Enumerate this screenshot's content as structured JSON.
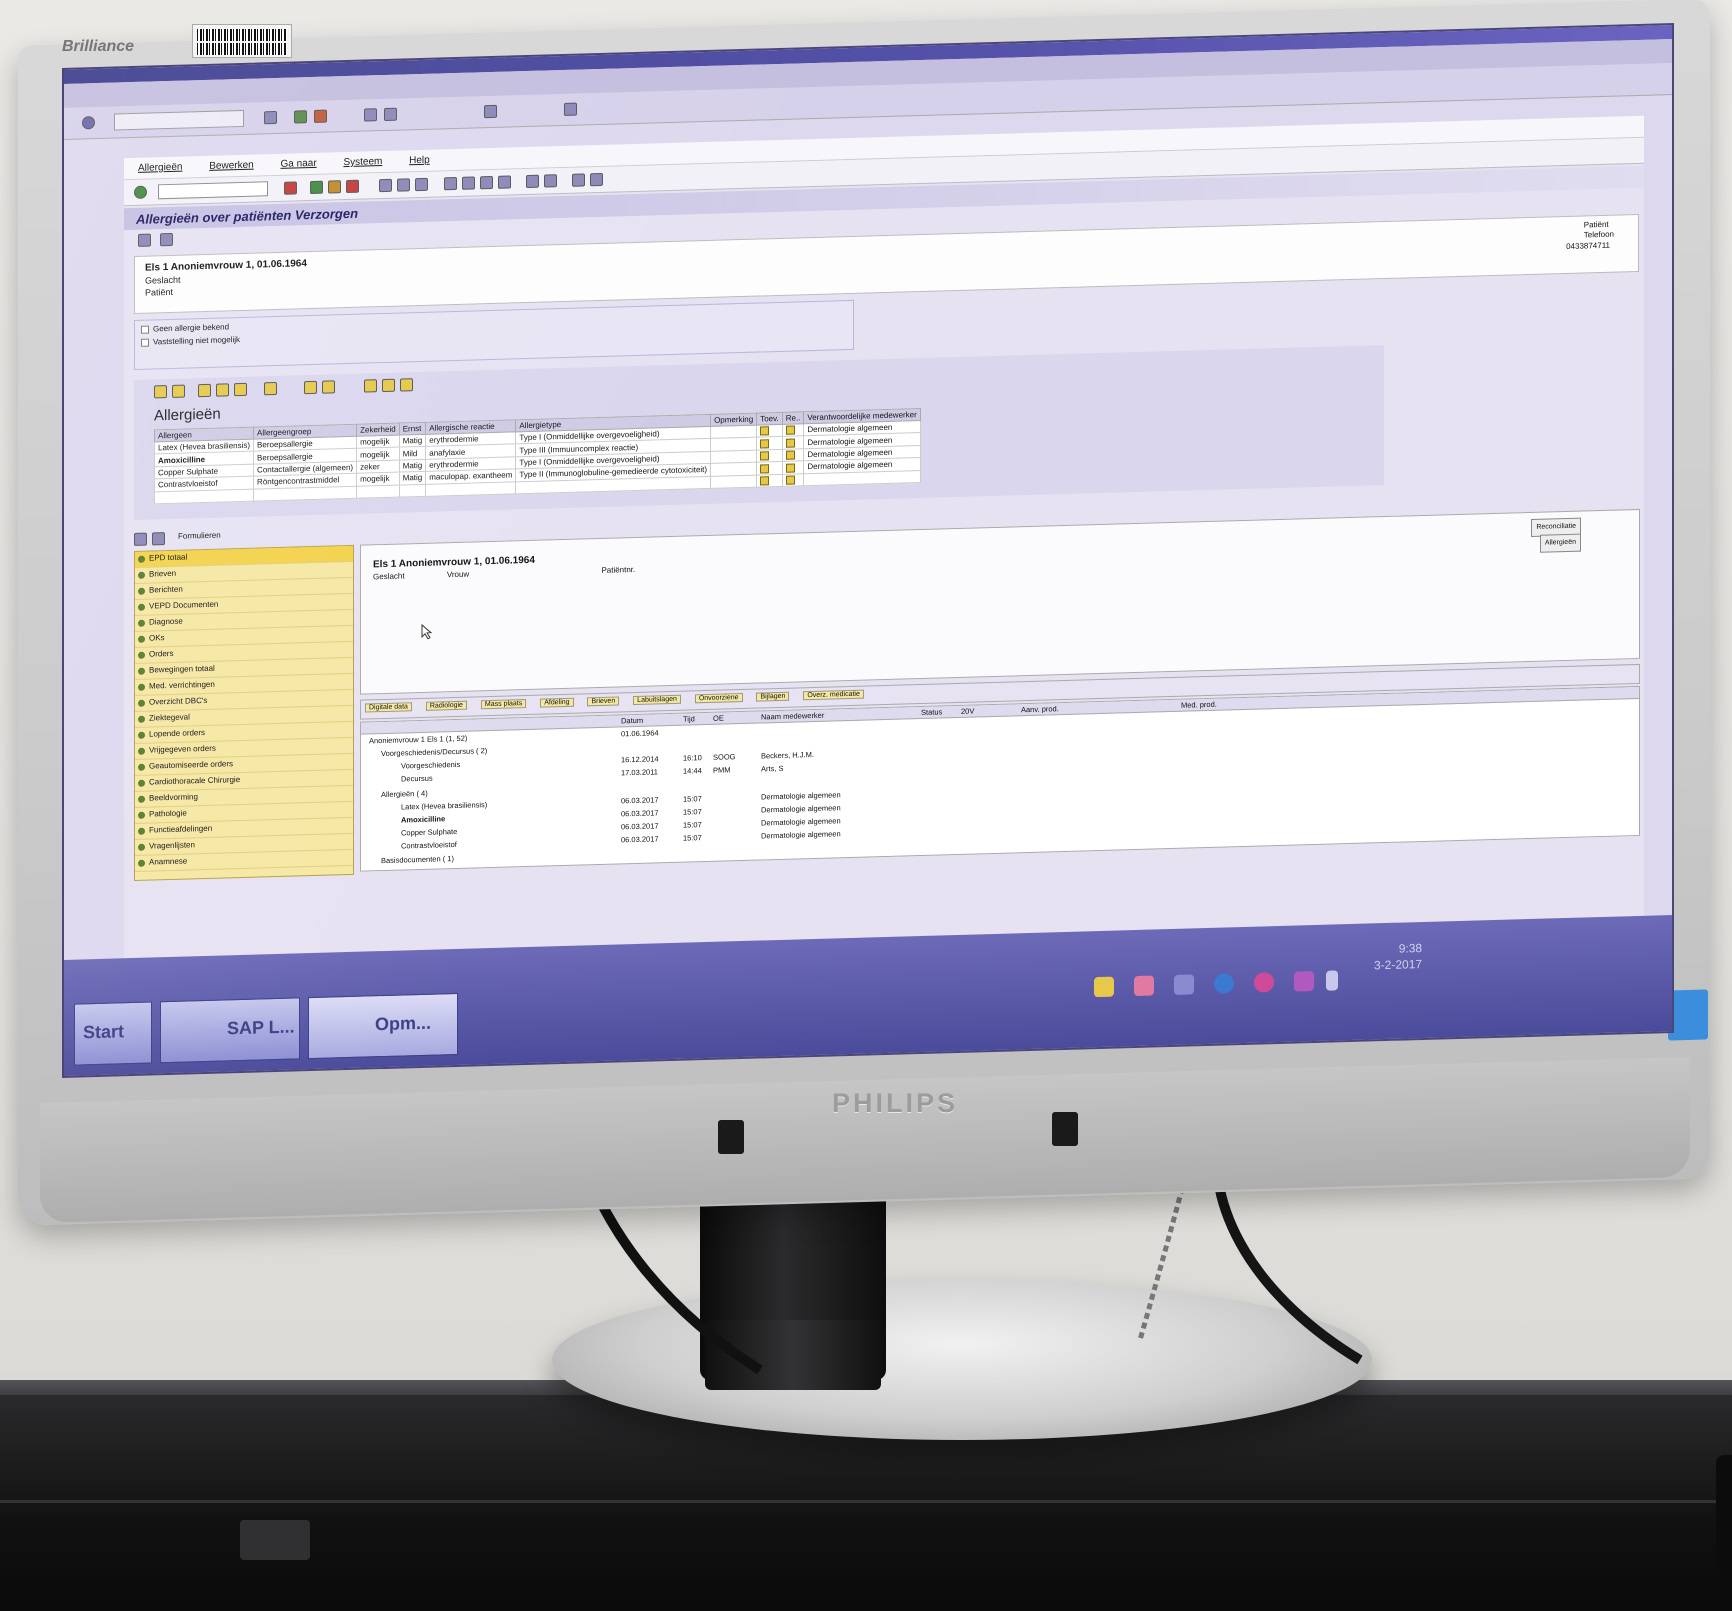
{
  "monitor": {
    "brand_top": "Brilliance",
    "logo": "PHILIPS"
  },
  "sap": {
    "menu": [
      "Allergieën",
      "Bewerken",
      "Ga naar",
      "Systeem",
      "Help"
    ],
    "title": "Allergieën over patiënten Verzorgen",
    "patient": {
      "name": "Els 1 Anoniemvrouw 1, 01.06.1964",
      "label_geslacht": "Geslacht",
      "label_patient": "Patiënt",
      "label_telefoon": "Telefoon",
      "phone": "0433874711"
    },
    "status_checkbox_1": "Geen allergie bekend",
    "status_checkbox_2": "Vaststelling niet mogelijk",
    "allergy_heading": "Allergieën",
    "allergy_columns": [
      "Allergeen",
      "Allergeengroep",
      "Zekerheid",
      "Ernst",
      "Allergische reactie",
      "Allergietype",
      "Opmerking",
      "Toev.",
      "Re..",
      "Verantwoordelijke medewerker"
    ],
    "allergy_rows": [
      [
        "Latex (Hevea brasiliensis)",
        "Beroepsallergie",
        "mogelijk",
        "Matig",
        "erythrodermie",
        "Type I (Onmiddellijke overgevoeligheid)",
        "",
        "Dermatologie algemeen"
      ],
      [
        "Amoxicilline",
        "Beroepsallergie",
        "mogelijk",
        "Mild",
        "anafylaxie",
        "Type III (Immuuncomplex reactie)",
        "",
        "Dermatologie algemeen"
      ],
      [
        "Copper Sulphate",
        "Contactallergie (algemeen)",
        "zeker",
        "Matig",
        "erythrodermie",
        "Type I (Onmiddellijke overgevoeligheid)",
        "",
        "Dermatologie algemeen"
      ],
      [
        "Contrastvloeistof",
        "Röntgencontrastmiddel",
        "mogelijk",
        "Matig",
        "maculopap. exantheem",
        "Type II (Immunoglobuline-gemedieerde cytotoxiciteit)",
        "",
        "Dermatologie algemeen"
      ]
    ],
    "form_label": "Formulieren",
    "nav": [
      "EPD totaal",
      "Brieven",
      "Berichten",
      "VEPD Documenten",
      "Diagnose",
      "OKs",
      "Orders",
      "Bewegingen totaal",
      "Med. verrichtingen",
      "Overzicht DBC's",
      "Ziektegeval",
      "Lopende orders",
      "Vrijgegeven orders",
      "Geautomiseerde orders",
      "Cardiothoracale Chirurgie",
      "Beeldvorming",
      "Pathologie",
      "Functieafdelingen",
      "Vragenlijsten",
      "Anamnese"
    ],
    "detail": {
      "name": "Els 1 Anoniemvrouw 1, 01.06.1964",
      "geslacht_label": "Geslacht",
      "geslacht_value": "Vrouw",
      "patient_label": "Patiëntnr.",
      "btn_reconciliatie": "Reconciliatie",
      "btn_allergieen": "Allergieën"
    },
    "doc_toolbar": [
      "Digitale data",
      "Radiologie",
      "Mass plaats",
      "Afdeling",
      "Brieven",
      "Labuitslagen",
      "Onvoorziene",
      "Bijlagen",
      "Overz. medicatie"
    ],
    "doc_columns": [
      "Datum",
      "Tijd",
      "OE",
      "Naam medewerker",
      "Status",
      "20V",
      "Aanv. prod.",
      "Med. prod."
    ],
    "doc_rows": [
      {
        "label": "Anoniemvrouw 1 Els 1 (1, 52)",
        "datum": "01.06.1964",
        "tijd": "",
        "oe": "",
        "naam": ""
      },
      {
        "label": "Voorgeschiedenis/Decursus ( 2)",
        "datum": "",
        "tijd": "",
        "oe": "",
        "naam": ""
      },
      {
        "label": "Voorgeschiedenis",
        "datum": "16.12.2014",
        "tijd": "16:10",
        "oe": "SOOG",
        "naam": "Beckers, H.J.M."
      },
      {
        "label": "Decursus",
        "datum": "17.03.2011",
        "tijd": "14:44",
        "oe": "PMM",
        "naam": "Arts, S"
      },
      {
        "label": "Allergieën ( 4)",
        "datum": "",
        "tijd": "",
        "oe": "",
        "naam": ""
      },
      {
        "label": "Latex (Hevea brasiliensis)",
        "datum": "06.03.2017",
        "tijd": "15:07",
        "oe": "",
        "naam": "Dermatologie algemeen"
      },
      {
        "label": "Amoxicilline",
        "datum": "06.03.2017",
        "tijd": "15:07",
        "oe": "",
        "naam": "Dermatologie algemeen"
      },
      {
        "label": "Copper Sulphate",
        "datum": "06.03.2017",
        "tijd": "15:07",
        "oe": "",
        "naam": "Dermatologie algemeen"
      },
      {
        "label": "Contrastvloeistof",
        "datum": "06.03.2017",
        "tijd": "15:07",
        "oe": "",
        "naam": "Dermatologie algemeen"
      },
      {
        "label": "Basisdocumenten ( 1)",
        "datum": "",
        "tijd": "",
        "oe": "",
        "naam": ""
      }
    ]
  },
  "taskbar": {
    "start": "Start",
    "task1": "SAP L...",
    "task2": "Opm...",
    "clock_time": "9:38",
    "clock_date": "3-2-2017"
  }
}
